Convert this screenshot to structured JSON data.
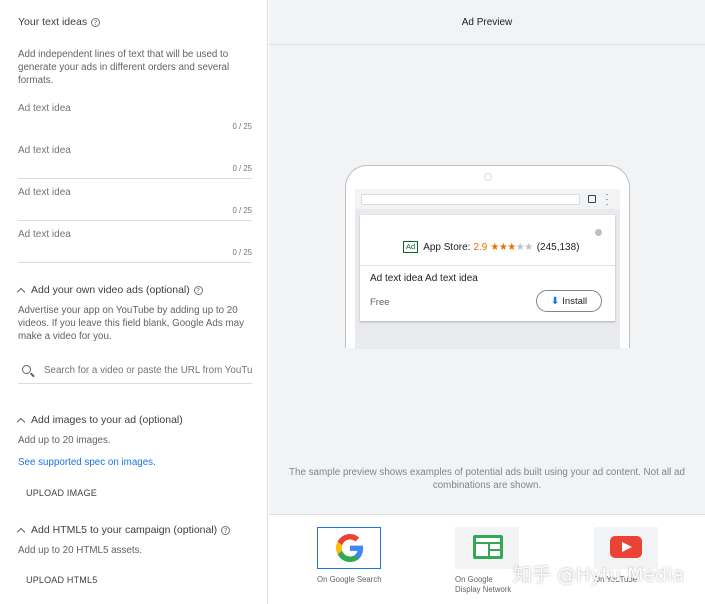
{
  "left": {
    "text_ideas": {
      "title": "Your text ideas",
      "description": "Add independent lines of text that will be used to generate your ads in different orders and several formats.",
      "fields": [
        {
          "placeholder": "Ad text idea",
          "counter": "0 / 25"
        },
        {
          "placeholder": "Ad text idea",
          "counter": "0 / 25"
        },
        {
          "placeholder": "Ad text idea",
          "counter": "0 / 25"
        },
        {
          "placeholder": "Ad text idea",
          "counter": "0 / 25"
        }
      ]
    },
    "videos": {
      "title": "Add your own video ads (optional)",
      "description": "Advertise your app on YouTube by adding up to 20 videos. If you leave this field blank, Google Ads may make a video for you.",
      "search_placeholder": "Search for a video or paste the URL from YouTube"
    },
    "images": {
      "title": "Add images to your ad (optional)",
      "description": "Add up to 20 images.",
      "link": "See supported spec on images.",
      "button": "UPLOAD IMAGE"
    },
    "html5": {
      "title": "Add HTML5 to your campaign (optional)",
      "description": "Add up to 20 HTML5 assets.",
      "button": "UPLOAD HTML5"
    }
  },
  "preview": {
    "header": "Ad Preview",
    "ad": {
      "badge": "Ad",
      "store": "App Store:",
      "rating": "2.9",
      "stars_filled": "★★★",
      "stars_empty": "★★",
      "reviews": "(245,138)",
      "headline": "Ad text idea Ad text idea",
      "price": "Free",
      "install": "Install"
    },
    "note": "The sample preview shows examples of potential ads built using your ad content. Not all ad combinations are shown.",
    "networks": [
      {
        "label": "On Google Search",
        "icon": "google-logo-icon"
      },
      {
        "label": "On Google\nDisplay Network",
        "label_line1": "On Google",
        "label_line2": "Display Network",
        "icon": "display-network-icon"
      },
      {
        "label": "On YouTube",
        "icon": "youtube-icon"
      }
    ]
  },
  "watermark": "知乎 @Hytu Media",
  "colors": {
    "accent": "#1a73e8",
    "star": "#e37400",
    "ad_badge": "#0d652d",
    "youtube": "#ea4335"
  }
}
